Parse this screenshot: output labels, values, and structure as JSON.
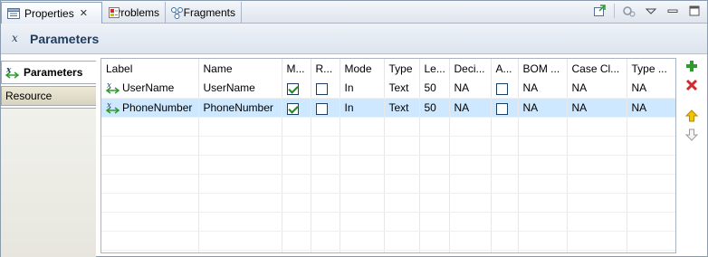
{
  "tabs": [
    {
      "label": "Properties",
      "active": true,
      "icon": "properties-icon"
    },
    {
      "label": "Problems",
      "active": false,
      "icon": "problems-icon"
    },
    {
      "label": "Fragments",
      "active": false,
      "icon": "fragments-icon"
    }
  ],
  "header": {
    "title": "Parameters",
    "icon": "parameter-icon"
  },
  "side_tabs": [
    {
      "label": "Parameters",
      "selected": true
    },
    {
      "label": "Resource",
      "selected": false
    }
  ],
  "table": {
    "columns": [
      "Label",
      "Name",
      "M...",
      "R...",
      "Mode",
      "Type",
      "Le...",
      "Deci...",
      "A...",
      "BOM ...",
      "Case Cl...",
      "Type ..."
    ],
    "rows": [
      {
        "label": "UserName",
        "name": "UserName",
        "m": true,
        "r": false,
        "mode": "In",
        "type": "Text",
        "length": "50",
        "decimal": "NA",
        "a": false,
        "bom": "NA",
        "case": "NA",
        "type2": "NA",
        "selected": false
      },
      {
        "label": "PhoneNumber",
        "name": "PhoneNumber",
        "m": true,
        "r": false,
        "mode": "In",
        "type": "Text",
        "length": "50",
        "decimal": "NA",
        "a": false,
        "bom": "NA",
        "case": "NA",
        "type2": "NA",
        "selected": true
      }
    ]
  },
  "actions": [
    "add-icon",
    "delete-icon",
    "move-up-icon",
    "move-down-icon"
  ],
  "colors": {
    "add": "#2e9a2e",
    "delete": "#d42a2a",
    "up": "#e6b400",
    "selection": "#cde8ff",
    "title": "#1e3d5f"
  }
}
